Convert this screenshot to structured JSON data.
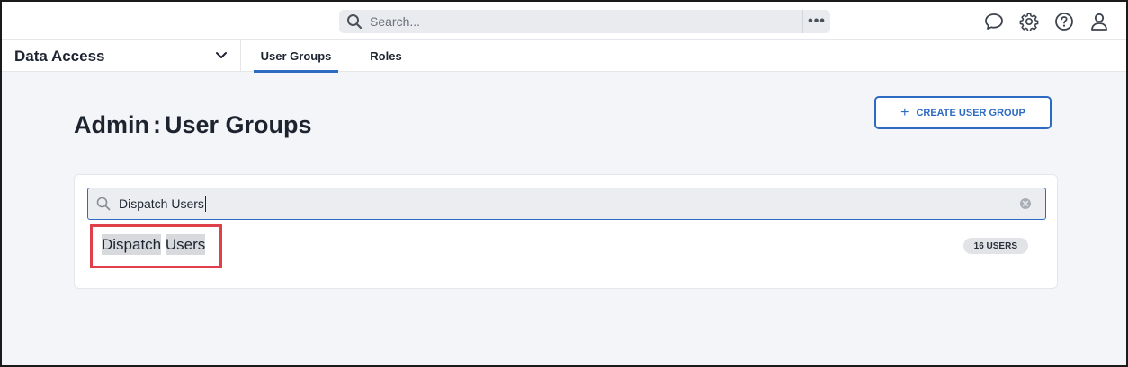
{
  "topbar": {
    "search_placeholder": "Search...",
    "more_label": "•••",
    "icons": [
      "chat-icon",
      "gear-icon",
      "help-icon",
      "user-icon"
    ]
  },
  "subnav": {
    "section_label": "Data Access",
    "tabs": [
      {
        "label": "User Groups",
        "active": true
      },
      {
        "label": "Roles",
        "active": false
      }
    ]
  },
  "page": {
    "title_prefix": "Admin",
    "title_separator": ":",
    "title": "User Groups",
    "create_button_label": "CREATE USER GROUP"
  },
  "filter": {
    "value": "Dispatch Users"
  },
  "results": [
    {
      "name_part1": "Dispatch",
      "name_part2": "Users",
      "count_label": "16 USERS"
    }
  ],
  "colors": {
    "accent": "#2d6bc2",
    "highlight_border": "#e0404a",
    "background": "#f4f5f8"
  }
}
